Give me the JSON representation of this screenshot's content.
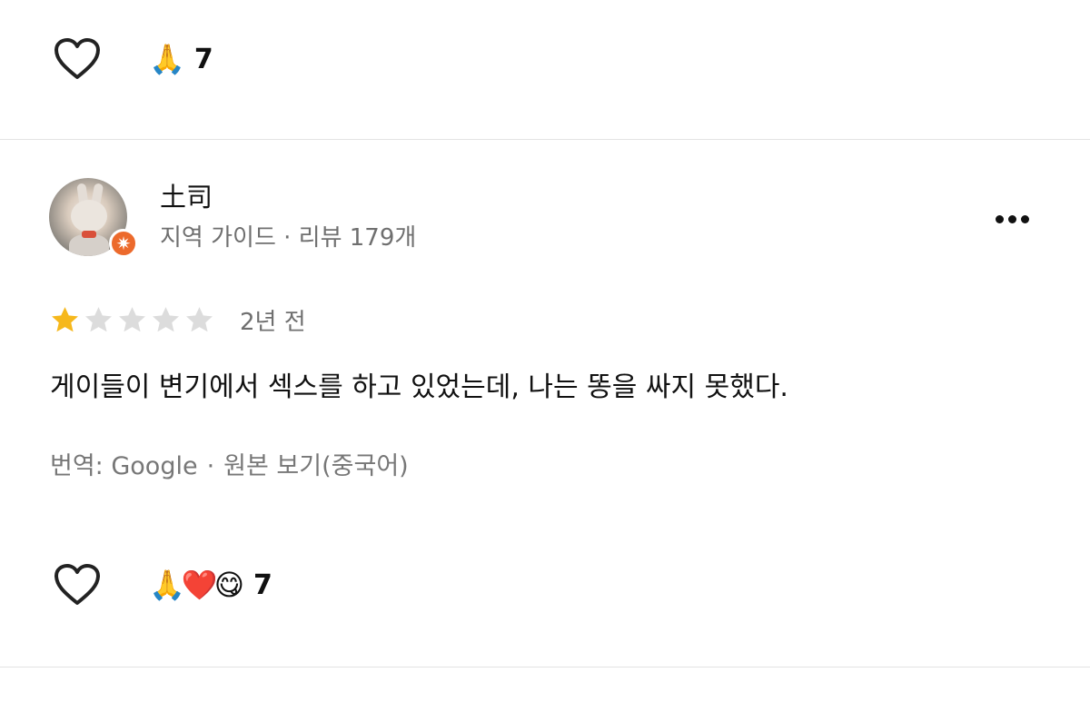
{
  "top_reactions": {
    "emojis": [
      "🙏"
    ],
    "count": "7"
  },
  "review": {
    "author_name": "土司",
    "author_meta": "지역 가이드 · 리뷰 179개",
    "rating": 1,
    "max_rating": 5,
    "date": "2년 전",
    "text": "게이들이 변기에서 섹스를 하고 있었는데, 나는 똥을 싸지 못했다.",
    "translation_label": "번역: Google",
    "separator": "·",
    "view_original_label": "원본 보기(중국어)",
    "reactions": {
      "emojis": [
        "🙏",
        "❤️",
        "😋"
      ],
      "count": "7"
    }
  },
  "colors": {
    "star_filled": "#f6b81c",
    "star_empty": "#dcdcdc",
    "guide_badge": "#ec6a2c",
    "divider": "#e3e3e3",
    "secondary_text": "#6f6f6f"
  },
  "icons": {
    "like": "heart-outline-icon",
    "more": "more-horizontal-icon",
    "badge": "local-guide-badge-icon"
  }
}
